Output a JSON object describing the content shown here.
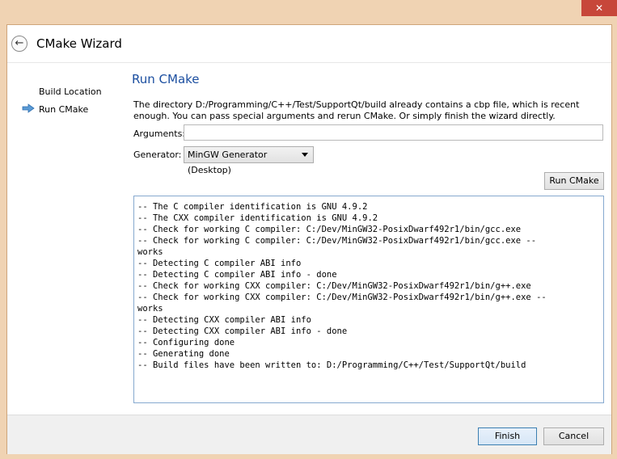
{
  "window": {
    "close_glyph": "✕"
  },
  "header": {
    "title": "CMake Wizard",
    "back_glyph": "←"
  },
  "sidebar": {
    "items": [
      {
        "label": "Build Location"
      },
      {
        "label": "Run CMake",
        "current": true
      }
    ]
  },
  "page": {
    "title": "Run CMake",
    "description": "The directory D:/Programming/C++/Test/SupportQt/build already contains a cbp file, which is recent enough. You can pass special arguments and rerun CMake. Or simply finish the wizard directly.",
    "arguments_label": "Arguments:",
    "arguments_value": "",
    "generator_label": "Generator:",
    "generator_value": "MinGW Generator (Desktop)",
    "run_button": "Run CMake"
  },
  "log": [
    "-- The C compiler identification is GNU 4.9.2",
    "-- The CXX compiler identification is GNU 4.9.2",
    "-- Check for working C compiler: C:/Dev/MinGW32-PosixDwarf492r1/bin/gcc.exe",
    "-- Check for working C compiler: C:/Dev/MinGW32-PosixDwarf492r1/bin/gcc.exe --",
    "works",
    "-- Detecting C compiler ABI info",
    "-- Detecting C compiler ABI info - done",
    "-- Check for working CXX compiler: C:/Dev/MinGW32-PosixDwarf492r1/bin/g++.exe",
    "-- Check for working CXX compiler: C:/Dev/MinGW32-PosixDwarf492r1/bin/g++.exe --",
    "works",
    "-- Detecting CXX compiler ABI info",
    "-- Detecting CXX compiler ABI info - done",
    "-- Configuring done",
    "-- Generating done",
    "-- Build files have been written to: D:/Programming/C++/Test/SupportQt/build"
  ],
  "footer": {
    "finish_label": "Finish",
    "cancel_label": "Cancel"
  },
  "colors": {
    "accent": "#1c4fa0",
    "close": "#c7473a",
    "frame": "#f0d3b3"
  },
  "icons": {
    "current_step": "right-arrow-icon",
    "back": "back-arrow-icon"
  }
}
